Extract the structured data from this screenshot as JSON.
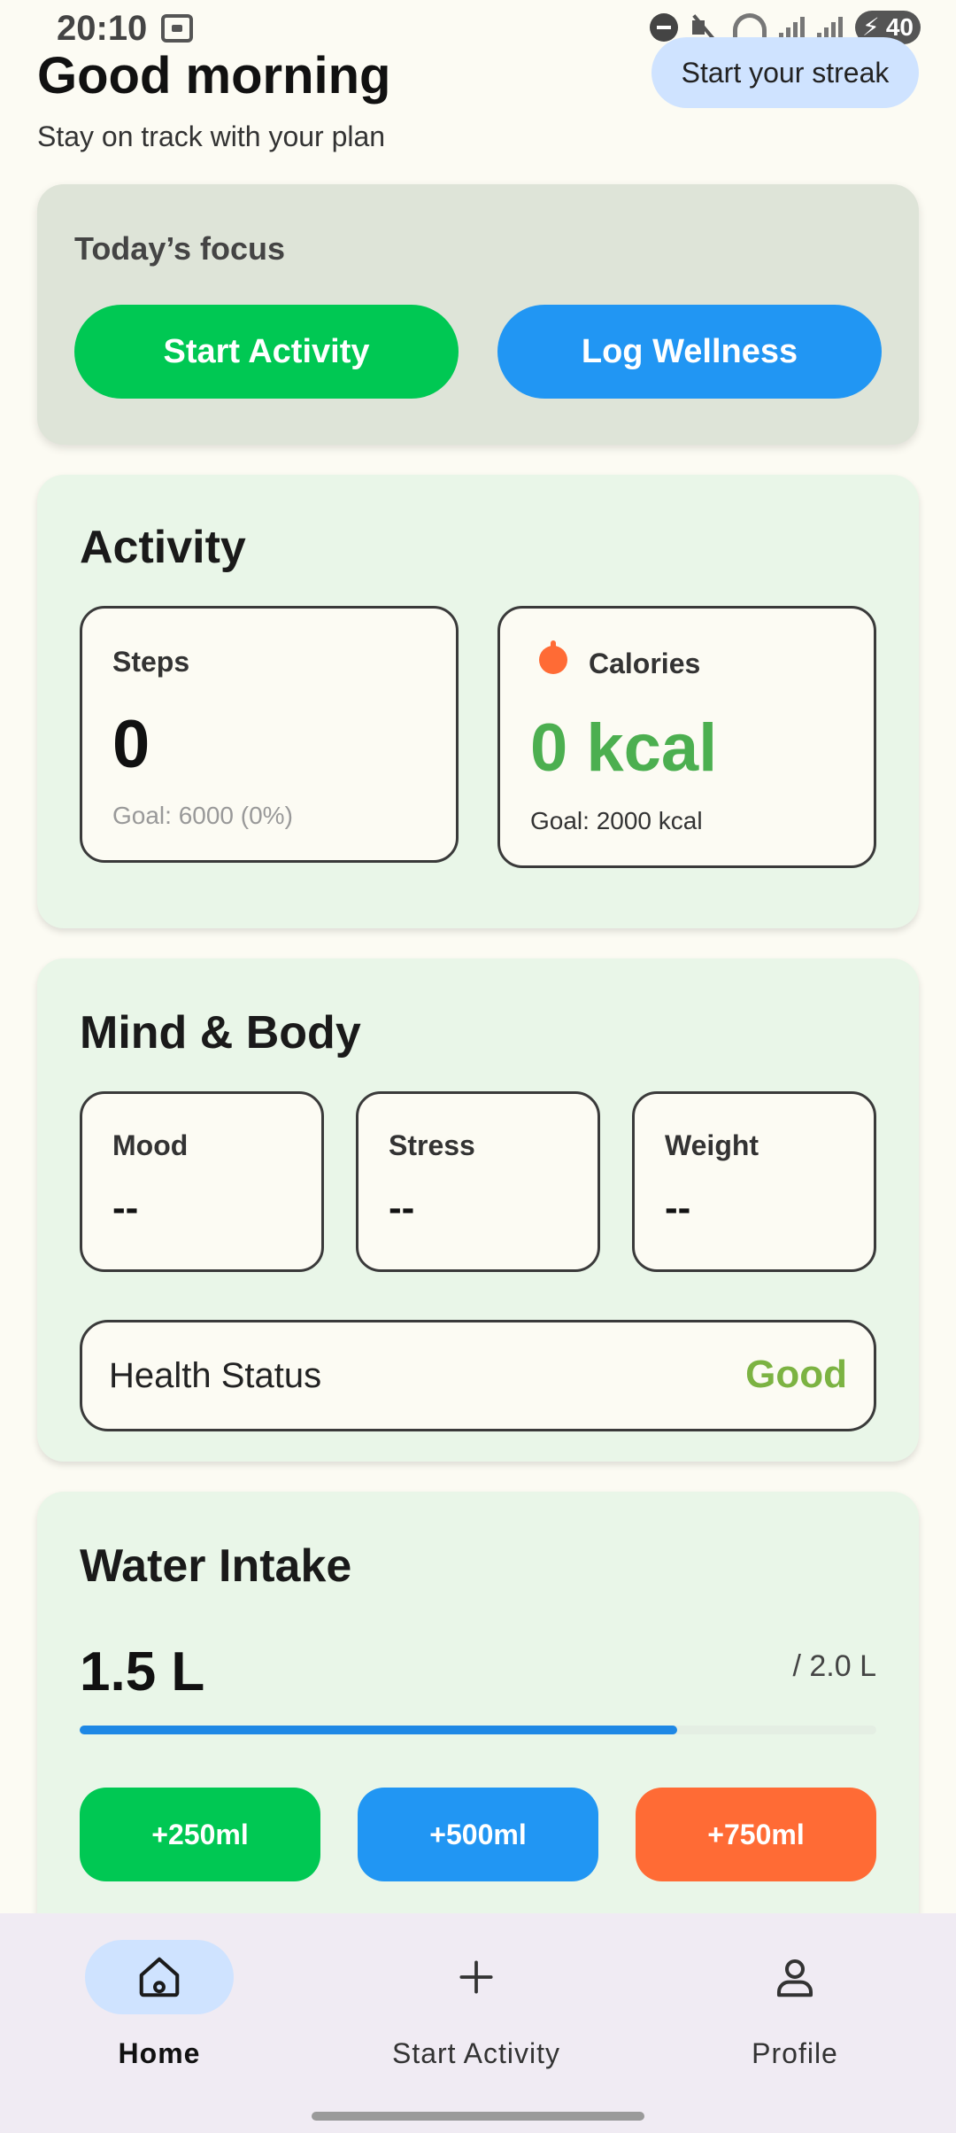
{
  "status_bar": {
    "time": "20:10",
    "battery": "40"
  },
  "header": {
    "greeting": "Good morning",
    "subtitle": "Stay on track with your plan",
    "streak_button": "Start your streak"
  },
  "focus": {
    "title": "Today’s focus",
    "start_activity": "Start Activity",
    "log_wellness": "Log Wellness"
  },
  "activity": {
    "title": "Activity",
    "steps_label": "Steps",
    "steps_value": "0",
    "steps_goal": "Goal: 6000 (0%)",
    "calories_label": "Calories",
    "calories_value": "0 kcal",
    "calories_goal": "Goal: 2000 kcal"
  },
  "mind_body": {
    "title": "Mind & Body",
    "mood_label": "Mood",
    "mood_value": "--",
    "stress_label": "Stress",
    "stress_value": "--",
    "weight_label": "Weight",
    "weight_value": "--",
    "health_label": "Health Status",
    "health_value": "Good"
  },
  "water": {
    "title": "Water Intake",
    "value": "1.5 L",
    "goal": "/ 2.0 L",
    "progress_fraction": 0.75,
    "buttons": [
      {
        "label": "+250ml",
        "color": "#00C853"
      },
      {
        "label": "+500ml",
        "color": "#2196F3"
      },
      {
        "label": "+750ml",
        "color": "#FF6B35"
      }
    ]
  },
  "bottom_nav": {
    "items": [
      {
        "label": "Home",
        "icon": "home-icon",
        "active": true
      },
      {
        "label": "Start Activity",
        "icon": "plus-icon",
        "active": false
      },
      {
        "label": "Profile",
        "icon": "person-icon",
        "active": false
      }
    ]
  },
  "colors": {
    "accent_green": "#00C853",
    "accent_blue": "#2196F3",
    "accent_orange": "#FF6B35",
    "calories_green": "#4CAF50",
    "health_good": "#7CB342"
  }
}
